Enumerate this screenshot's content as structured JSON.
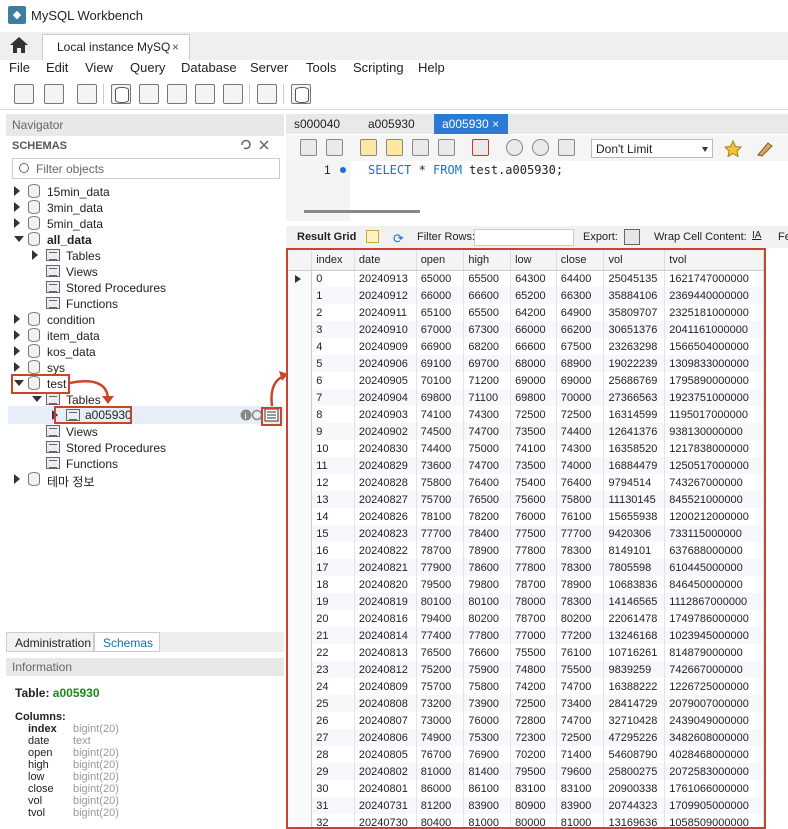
{
  "app": {
    "title": "MySQL Workbench",
    "connection_tab": "Local instance MySQ",
    "close": "×"
  },
  "menu": [
    "File",
    "Edit",
    "View",
    "Query",
    "Database",
    "Server",
    "Tools",
    "Scripting",
    "Help"
  ],
  "navigator": {
    "header": "Navigator",
    "schemas_label": "SCHEMAS",
    "filter_placeholder": "Filter objects",
    "tree": [
      {
        "label": "15min_data",
        "bold": false
      },
      {
        "label": "3min_data",
        "bold": false
      },
      {
        "label": "5min_data",
        "bold": false
      },
      {
        "label": "all_data",
        "bold": true
      },
      {
        "label": "Tables"
      },
      {
        "label": "Views"
      },
      {
        "label": "Stored Procedures"
      },
      {
        "label": "Functions"
      },
      {
        "label": "condition"
      },
      {
        "label": "item_data"
      },
      {
        "label": "kos_data"
      },
      {
        "label": "sys"
      },
      {
        "label": "test",
        "bold": false
      },
      {
        "label": "Tables"
      },
      {
        "label": "a005930"
      },
      {
        "label": "Views"
      },
      {
        "label": "Stored Procedures"
      },
      {
        "label": "Functions"
      },
      {
        "label": "테마 정보"
      }
    ],
    "bottom_tabs": {
      "administration": "Administration",
      "schemas": "Schemas"
    },
    "info_header": "Information",
    "table_label": "Table:",
    "table_name": "a005930",
    "columns_label": "Columns:",
    "columns": [
      {
        "name": "index",
        "type": "bigint(20)",
        "bold": true
      },
      {
        "name": "date",
        "type": "text"
      },
      {
        "name": "open",
        "type": "bigint(20)"
      },
      {
        "name": "high",
        "type": "bigint(20)"
      },
      {
        "name": "low",
        "type": "bigint(20)"
      },
      {
        "name": "close",
        "type": "bigint(20)"
      },
      {
        "name": "vol",
        "type": "bigint(20)"
      },
      {
        "name": "tvol",
        "type": "bigint(20)"
      }
    ]
  },
  "query_tabs": [
    "s000040",
    "a005930",
    "a005930"
  ],
  "editor": {
    "limit": "Don't Limit",
    "line": "1",
    "sql_kw1": "SELECT",
    "sql_mid": " * ",
    "sql_kw2": "FROM",
    "sql_rest": " test.a005930;"
  },
  "result_toolbar": {
    "result_grid": "Result Grid",
    "filter_rows": "Filter Rows:",
    "export": "Export:",
    "wrap": "Wrap Cell Content:",
    "more": "Fe"
  },
  "grid": {
    "headers": [
      "index",
      "date",
      "open",
      "high",
      "low",
      "close",
      "vol",
      "tvol"
    ],
    "rows": [
      [
        "0",
        "20240913",
        "65000",
        "65500",
        "64300",
        "64400",
        "25045135",
        "1621747000000"
      ],
      [
        "1",
        "20240912",
        "66000",
        "66600",
        "65200",
        "66300",
        "35884106",
        "2369440000000"
      ],
      [
        "2",
        "20240911",
        "65100",
        "65500",
        "64200",
        "64900",
        "35809707",
        "2325181000000"
      ],
      [
        "3",
        "20240910",
        "67000",
        "67300",
        "66000",
        "66200",
        "30651376",
        "2041161000000"
      ],
      [
        "4",
        "20240909",
        "66900",
        "68200",
        "66600",
        "67500",
        "23263298",
        "1566504000000"
      ],
      [
        "5",
        "20240906",
        "69100",
        "69700",
        "68000",
        "68900",
        "19022239",
        "1309833000000"
      ],
      [
        "6",
        "20240905",
        "70100",
        "71200",
        "69000",
        "69000",
        "25686769",
        "1795890000000"
      ],
      [
        "7",
        "20240904",
        "69800",
        "71100",
        "69800",
        "70000",
        "27366563",
        "1923751000000"
      ],
      [
        "8",
        "20240903",
        "74100",
        "74300",
        "72500",
        "72500",
        "16314599",
        "1195017000000"
      ],
      [
        "9",
        "20240902",
        "74500",
        "74700",
        "73500",
        "74400",
        "12641376",
        "938130000000"
      ],
      [
        "10",
        "20240830",
        "74400",
        "75000",
        "74100",
        "74300",
        "16358520",
        "1217838000000"
      ],
      [
        "11",
        "20240829",
        "73600",
        "74700",
        "73500",
        "74000",
        "16884479",
        "1250517000000"
      ],
      [
        "12",
        "20240828",
        "75800",
        "76400",
        "75400",
        "76400",
        "9794514",
        "743267000000"
      ],
      [
        "13",
        "20240827",
        "75700",
        "76500",
        "75600",
        "75800",
        "11130145",
        "845521000000"
      ],
      [
        "14",
        "20240826",
        "78100",
        "78200",
        "76000",
        "76100",
        "15655938",
        "1200212000000"
      ],
      [
        "15",
        "20240823",
        "77700",
        "78400",
        "77500",
        "77700",
        "9420306",
        "733115000000"
      ],
      [
        "16",
        "20240822",
        "78700",
        "78900",
        "77800",
        "78300",
        "8149101",
        "637688000000"
      ],
      [
        "17",
        "20240821",
        "77900",
        "78600",
        "77800",
        "78300",
        "7805598",
        "610445000000"
      ],
      [
        "18",
        "20240820",
        "79500",
        "79800",
        "78700",
        "78900",
        "10683836",
        "846450000000"
      ],
      [
        "19",
        "20240819",
        "80100",
        "80100",
        "78000",
        "78300",
        "14146565",
        "1112867000000"
      ],
      [
        "20",
        "20240816",
        "79400",
        "80200",
        "78700",
        "80200",
        "22061478",
        "1749786000000"
      ],
      [
        "21",
        "20240814",
        "77400",
        "77800",
        "77000",
        "77200",
        "13246168",
        "1023945000000"
      ],
      [
        "22",
        "20240813",
        "76500",
        "76600",
        "75500",
        "76100",
        "10716261",
        "814879000000"
      ],
      [
        "23",
        "20240812",
        "75200",
        "75900",
        "74800",
        "75500",
        "9839259",
        "742667000000"
      ],
      [
        "24",
        "20240809",
        "75700",
        "75800",
        "74200",
        "74700",
        "16388222",
        "1226725000000"
      ],
      [
        "25",
        "20240808",
        "73200",
        "73900",
        "72500",
        "73400",
        "28414729",
        "2079007000000"
      ],
      [
        "26",
        "20240807",
        "73000",
        "76000",
        "72800",
        "74700",
        "32710428",
        "2439049000000"
      ],
      [
        "27",
        "20240806",
        "74900",
        "75300",
        "72300",
        "72500",
        "47295226",
        "3482608000000"
      ],
      [
        "28",
        "20240805",
        "76700",
        "76900",
        "70200",
        "71400",
        "54608790",
        "4028468000000"
      ],
      [
        "29",
        "20240802",
        "81000",
        "81400",
        "79500",
        "79600",
        "25800275",
        "2072583000000"
      ],
      [
        "30",
        "20240801",
        "86000",
        "86100",
        "83100",
        "83100",
        "20900338",
        "1761066000000"
      ],
      [
        "31",
        "20240731",
        "81200",
        "83900",
        "80900",
        "83900",
        "20744323",
        "1709905000000"
      ],
      [
        "32",
        "20240730",
        "80400",
        "81000",
        "80000",
        "81000",
        "13169636",
        "1058509000000"
      ]
    ]
  },
  "colors": {
    "accent": "#2b7ad6",
    "annotation": "#c9452a",
    "info_green": "#1b8a1b"
  }
}
